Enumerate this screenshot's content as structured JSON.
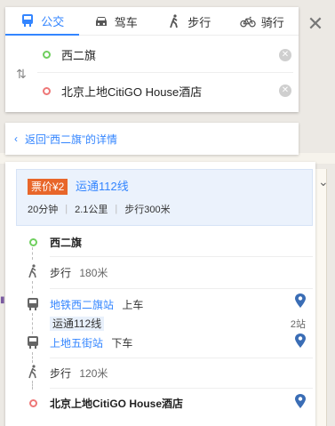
{
  "modes": [
    {
      "label": "公交",
      "icon": "bus-icon",
      "active": true
    },
    {
      "label": "驾车",
      "icon": "car-icon",
      "active": false
    },
    {
      "label": "步行",
      "icon": "walk-icon",
      "active": false
    },
    {
      "label": "骑行",
      "icon": "bike-icon",
      "active": false
    }
  ],
  "origin": "西二旗",
  "destination": "北京上地CitiGO House酒店",
  "back_link": "返回“西二旗”的详情",
  "summary": {
    "price": "票价¥2",
    "line": "运通112线",
    "duration": "20分钟",
    "distance": "2.1公里",
    "walk": "步行300米"
  },
  "steps": {
    "start": "西二旗",
    "walk1_label": "步行",
    "walk1_dist": "180米",
    "board_station": "地铁西二旗站",
    "board_action": "上车",
    "route_tag": "运通112线",
    "stop_count": "2站",
    "alight_station": "上地五街站",
    "alight_action": "下车",
    "walk2_label": "步行",
    "walk2_dist": "120米",
    "end": "北京上地CitiGO House酒店"
  },
  "colors": {
    "accent": "#3385ff",
    "price_badge": "#e8662a",
    "origin_dot": "#6fcf5e",
    "dest_dot": "#ee7777"
  }
}
